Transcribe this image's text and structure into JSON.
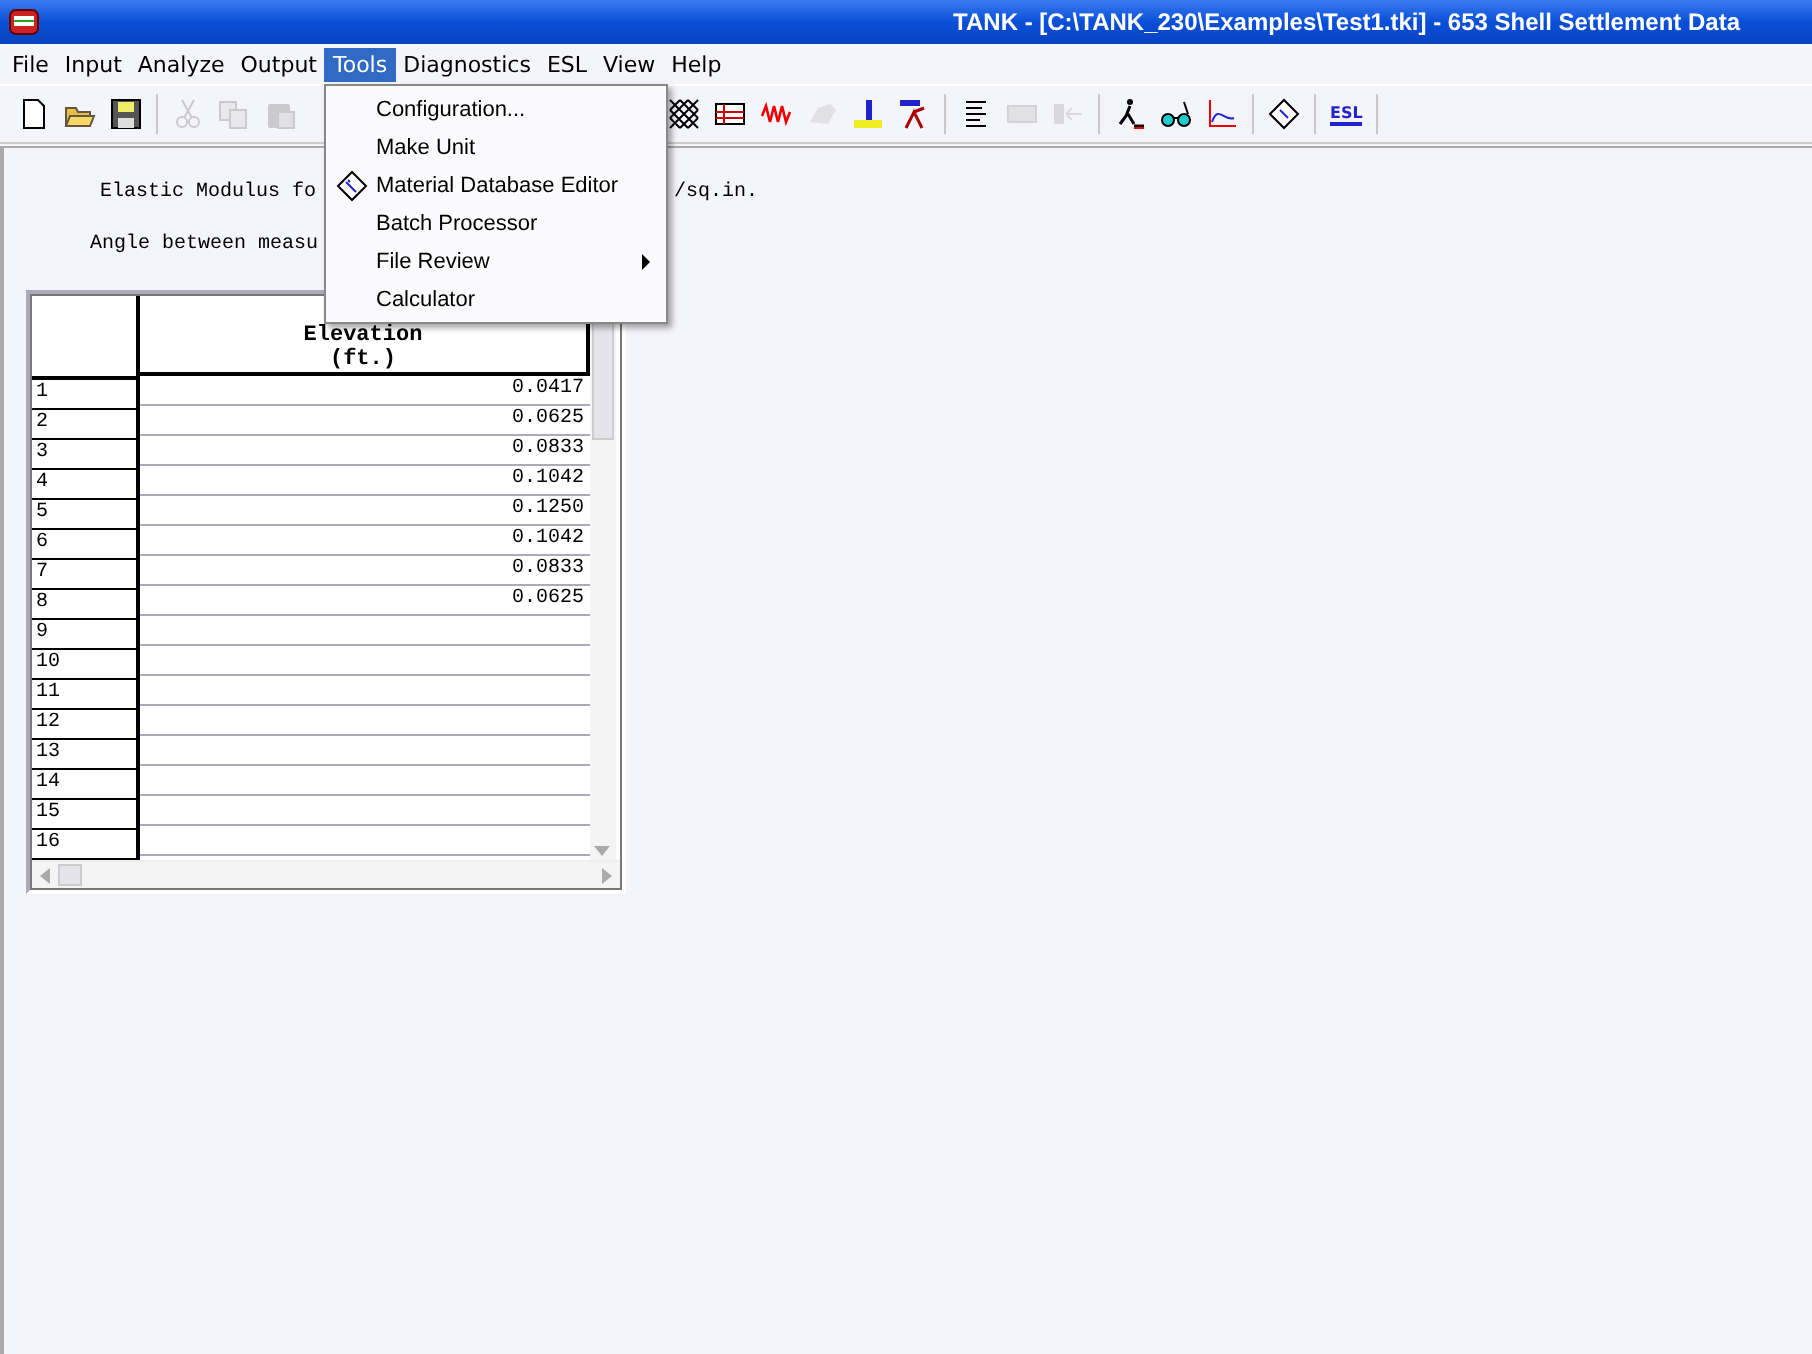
{
  "window": {
    "title": "TANK - [C:\\TANK_230\\Examples\\Test1.tki] - 653 Shell Settlement Data"
  },
  "menu": [
    {
      "label": "File",
      "selected": false
    },
    {
      "label": "Input",
      "selected": false
    },
    {
      "label": "Analyze",
      "selected": false
    },
    {
      "label": "Output",
      "selected": false
    },
    {
      "label": "Tools",
      "selected": true
    },
    {
      "label": "Diagnostics",
      "selected": false
    },
    {
      "label": "ESL",
      "selected": false
    },
    {
      "label": "View",
      "selected": false
    },
    {
      "label": "Help",
      "selected": false
    }
  ],
  "toolbar_left": [
    {
      "kind": "new",
      "disabled": false
    },
    {
      "kind": "open",
      "disabled": false
    },
    {
      "kind": "save",
      "disabled": false
    },
    {
      "kind": "sep"
    },
    {
      "kind": "cut",
      "disabled": true
    },
    {
      "kind": "copy",
      "disabled": true
    },
    {
      "kind": "paste",
      "disabled": true
    }
  ],
  "toolbar_right": [
    {
      "kind": "hatch",
      "disabled": false
    },
    {
      "kind": "table",
      "disabled": false
    },
    {
      "kind": "wave",
      "disabled": false
    },
    {
      "kind": "blob",
      "disabled": true
    },
    {
      "kind": "ruler",
      "disabled": false
    },
    {
      "kind": "year",
      "disabled": false
    },
    {
      "kind": "sep"
    },
    {
      "kind": "lines",
      "disabled": false
    },
    {
      "kind": "keyboard",
      "disabled": true
    },
    {
      "kind": "arrow",
      "disabled": true
    },
    {
      "kind": "sep"
    },
    {
      "kind": "walker",
      "disabled": false
    },
    {
      "kind": "glasses",
      "disabled": false
    },
    {
      "kind": "graph",
      "disabled": false
    },
    {
      "kind": "sep"
    },
    {
      "kind": "book",
      "disabled": false
    },
    {
      "kind": "sep"
    },
    {
      "kind": "esl",
      "label": "ESL",
      "disabled": false
    }
  ],
  "tools_menu": [
    {
      "label": "Configuration...",
      "icon": false,
      "submenu": false
    },
    {
      "label": "Make Unit",
      "icon": false,
      "submenu": false
    },
    {
      "label": "Material Database Editor",
      "icon": true,
      "submenu": false
    },
    {
      "label": "Batch Processor",
      "icon": false,
      "submenu": false
    },
    {
      "label": "File Review",
      "icon": false,
      "submenu": true
    },
    {
      "label": "Calculator",
      "icon": false,
      "submenu": false
    }
  ],
  "form": {
    "line_1_start": "Elastic Modulus fo",
    "line_1_end": "/sq.in.",
    "line_2_start": "Angle between measu"
  },
  "table": {
    "column": "Elevation",
    "unit": "(ft.)",
    "rows": [
      {
        "index": "1",
        "value": "0.0417"
      },
      {
        "index": "2",
        "value": "0.0625"
      },
      {
        "index": "3",
        "value": "0.0833"
      },
      {
        "index": "4",
        "value": "0.1042"
      },
      {
        "index": "5",
        "value": "0.1250"
      },
      {
        "index": "6",
        "value": "0.1042"
      },
      {
        "index": "7",
        "value": "0.0833"
      },
      {
        "index": "8",
        "value": "0.0625"
      },
      {
        "index": "9"
      },
      {
        "index": "10"
      },
      {
        "index": "11"
      },
      {
        "index": "12"
      },
      {
        "index": "13"
      },
      {
        "index": "14"
      },
      {
        "index": "15"
      },
      {
        "index": "16"
      }
    ]
  }
}
